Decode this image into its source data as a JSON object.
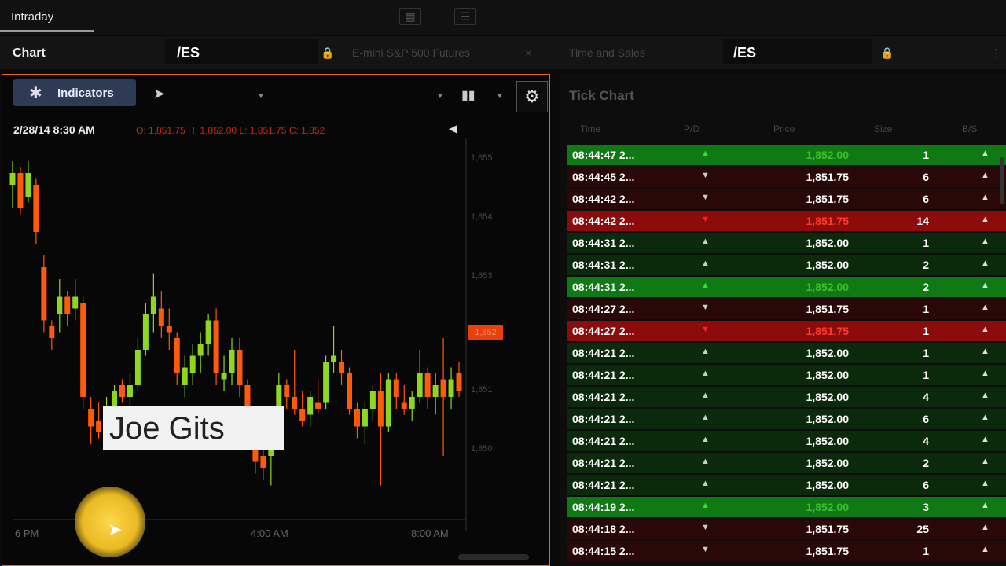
{
  "topbar": {
    "tab": "Intraday"
  },
  "header": {
    "chart_label": "Chart",
    "chart_symbol": "/ES",
    "instrument_name": "E-mini S&P 500 Futures",
    "time_sales_label": "Time and Sales",
    "ts_symbol": "/ES"
  },
  "chart": {
    "indicators_label": "Indicators",
    "datetime": "2/28/14 8:30 AM",
    "ohlc": "O: 1,851.75 H: 1,852.00 L: 1,851.75 C: 1,852",
    "watermark": "Joe Gits",
    "x_ticks": [
      "6 PM",
      "4:00 AM",
      "8:00 AM"
    ],
    "y_ticks": [
      "1,855",
      "1,854",
      "1,853",
      "1,852",
      "1,851",
      "1,850"
    ],
    "current_price": "1,852",
    "colors": {
      "up": "#8fd61e",
      "down": "#ff5a0a",
      "panel_border": "#e86a14"
    }
  },
  "chart_data": {
    "type": "candlestick",
    "title": "",
    "candles": [
      {
        "o": 1855.8,
        "h": 1856.2,
        "l": 1855.4,
        "c": 1856.0
      },
      {
        "o": 1856.0,
        "h": 1856.1,
        "l": 1855.3,
        "c": 1855.4
      },
      {
        "o": 1855.6,
        "h": 1856.2,
        "l": 1855.5,
        "c": 1856.0
      },
      {
        "o": 1855.8,
        "h": 1855.9,
        "l": 1854.8,
        "c": 1855.0
      },
      {
        "o": 1854.4,
        "h": 1854.6,
        "l": 1853.3,
        "c": 1853.5
      },
      {
        "o": 1853.4,
        "h": 1853.5,
        "l": 1853.0,
        "c": 1853.2
      },
      {
        "o": 1853.6,
        "h": 1854.2,
        "l": 1853.3,
        "c": 1853.9
      },
      {
        "o": 1853.9,
        "h": 1854.0,
        "l": 1853.4,
        "c": 1853.6
      },
      {
        "o": 1853.7,
        "h": 1854.2,
        "l": 1853.5,
        "c": 1853.9
      },
      {
        "o": 1853.8,
        "h": 1853.9,
        "l": 1852.0,
        "c": 1852.2
      },
      {
        "o": 1852.0,
        "h": 1852.2,
        "l": 1851.4,
        "c": 1851.7
      },
      {
        "o": 1851.8,
        "h": 1852.1,
        "l": 1851.5,
        "c": 1851.6
      },
      {
        "o": 1851.6,
        "h": 1852.2,
        "l": 1851.3,
        "c": 1852.0
      },
      {
        "o": 1852.0,
        "h": 1852.4,
        "l": 1851.9,
        "c": 1852.3
      },
      {
        "o": 1852.4,
        "h": 1852.5,
        "l": 1852.1,
        "c": 1852.2
      },
      {
        "o": 1852.2,
        "h": 1852.6,
        "l": 1852.0,
        "c": 1852.4
      },
      {
        "o": 1852.4,
        "h": 1853.2,
        "l": 1852.3,
        "c": 1853.0
      },
      {
        "o": 1853.0,
        "h": 1853.8,
        "l": 1852.9,
        "c": 1853.6
      },
      {
        "o": 1853.6,
        "h": 1854.3,
        "l": 1853.3,
        "c": 1853.9
      },
      {
        "o": 1853.7,
        "h": 1854.0,
        "l": 1853.2,
        "c": 1853.4
      },
      {
        "o": 1853.4,
        "h": 1853.7,
        "l": 1853.0,
        "c": 1853.3
      },
      {
        "o": 1853.2,
        "h": 1853.3,
        "l": 1852.4,
        "c": 1852.6
      },
      {
        "o": 1852.4,
        "h": 1852.9,
        "l": 1852.2,
        "c": 1852.7
      },
      {
        "o": 1852.6,
        "h": 1853.1,
        "l": 1852.4,
        "c": 1852.9
      },
      {
        "o": 1852.9,
        "h": 1853.3,
        "l": 1852.6,
        "c": 1853.1
      },
      {
        "o": 1853.1,
        "h": 1853.6,
        "l": 1852.9,
        "c": 1853.5
      },
      {
        "o": 1853.5,
        "h": 1853.7,
        "l": 1852.4,
        "c": 1852.6
      },
      {
        "o": 1852.5,
        "h": 1852.9,
        "l": 1852.3,
        "c": 1852.6
      },
      {
        "o": 1852.6,
        "h": 1853.2,
        "l": 1852.4,
        "c": 1853.0
      },
      {
        "o": 1853.0,
        "h": 1853.2,
        "l": 1852.2,
        "c": 1852.4
      },
      {
        "o": 1852.4,
        "h": 1852.5,
        "l": 1851.6,
        "c": 1851.8
      },
      {
        "o": 1851.9,
        "h": 1852.0,
        "l": 1850.9,
        "c": 1851.1
      },
      {
        "o": 1851.2,
        "h": 1851.3,
        "l": 1850.8,
        "c": 1851.0
      },
      {
        "o": 1851.2,
        "h": 1851.8,
        "l": 1850.7,
        "c": 1851.6
      },
      {
        "o": 1851.7,
        "h": 1852.6,
        "l": 1851.6,
        "c": 1852.4
      },
      {
        "o": 1852.4,
        "h": 1852.5,
        "l": 1852.0,
        "c": 1852.2
      },
      {
        "o": 1852.2,
        "h": 1853.0,
        "l": 1851.9,
        "c": 1852.0
      },
      {
        "o": 1852.0,
        "h": 1852.3,
        "l": 1851.7,
        "c": 1851.8
      },
      {
        "o": 1851.9,
        "h": 1852.3,
        "l": 1851.7,
        "c": 1852.2
      },
      {
        "o": 1852.1,
        "h": 1852.5,
        "l": 1851.9,
        "c": 1852.0
      },
      {
        "o": 1852.1,
        "h": 1852.9,
        "l": 1852.0,
        "c": 1852.8
      },
      {
        "o": 1852.8,
        "h": 1853.4,
        "l": 1852.6,
        "c": 1852.9
      },
      {
        "o": 1852.8,
        "h": 1853.0,
        "l": 1852.4,
        "c": 1852.6
      },
      {
        "o": 1852.6,
        "h": 1852.7,
        "l": 1851.9,
        "c": 1852.0
      },
      {
        "o": 1852.0,
        "h": 1852.1,
        "l": 1851.5,
        "c": 1851.7
      },
      {
        "o": 1851.7,
        "h": 1852.1,
        "l": 1851.4,
        "c": 1852.0
      },
      {
        "o": 1852.0,
        "h": 1852.4,
        "l": 1851.8,
        "c": 1852.3
      },
      {
        "o": 1852.3,
        "h": 1852.6,
        "l": 1850.7,
        "c": 1851.7
      },
      {
        "o": 1851.7,
        "h": 1852.6,
        "l": 1851.6,
        "c": 1852.5
      },
      {
        "o": 1852.5,
        "h": 1852.6,
        "l": 1852.0,
        "c": 1852.2
      },
      {
        "o": 1852.1,
        "h": 1852.4,
        "l": 1851.9,
        "c": 1852.0
      },
      {
        "o": 1852.0,
        "h": 1852.3,
        "l": 1851.8,
        "c": 1852.2
      },
      {
        "o": 1852.2,
        "h": 1853.0,
        "l": 1852.1,
        "c": 1852.6
      },
      {
        "o": 1852.6,
        "h": 1852.7,
        "l": 1852.0,
        "c": 1852.2
      },
      {
        "o": 1852.2,
        "h": 1852.6,
        "l": 1851.9,
        "c": 1852.4
      },
      {
        "o": 1852.5,
        "h": 1853.2,
        "l": 1851.2,
        "c": 1852.2
      },
      {
        "o": 1852.2,
        "h": 1852.7,
        "l": 1852.0,
        "c": 1852.5
      },
      {
        "o": 1852.6,
        "h": 1852.8,
        "l": 1852.2,
        "c": 1852.3
      }
    ],
    "ylim": [
      1850.2,
      1856.6
    ],
    "xlabel": "",
    "ylabel": ""
  },
  "tick_chart": {
    "title": "Tick Chart",
    "columns": [
      "Time",
      "P/D",
      "Price",
      "Size",
      "B/S"
    ],
    "rows": [
      {
        "time": "08:44:47 2...",
        "dir": "up",
        "price": "1,852.00",
        "size": "1",
        "kind": "up-strong"
      },
      {
        "time": "08:44:45 2...",
        "dir": "down",
        "price": "1,851.75",
        "size": "6",
        "kind": "down-dim"
      },
      {
        "time": "08:44:42 2...",
        "dir": "down",
        "price": "1,851.75",
        "size": "6",
        "kind": "down-dim"
      },
      {
        "time": "08:44:42 2...",
        "dir": "down",
        "price": "1,851.75",
        "size": "14",
        "kind": "down-strong"
      },
      {
        "time": "08:44:31 2...",
        "dir": "up",
        "price": "1,852.00",
        "size": "1",
        "kind": "up-dim"
      },
      {
        "time": "08:44:31 2...",
        "dir": "up",
        "price": "1,852.00",
        "size": "2",
        "kind": "up-dim"
      },
      {
        "time": "08:44:31 2...",
        "dir": "up",
        "price": "1,852.00",
        "size": "2",
        "kind": "up-strong"
      },
      {
        "time": "08:44:27 2...",
        "dir": "down",
        "price": "1,851.75",
        "size": "1",
        "kind": "down-dim"
      },
      {
        "time": "08:44:27 2...",
        "dir": "down",
        "price": "1,851.75",
        "size": "1",
        "kind": "down-strong"
      },
      {
        "time": "08:44:21 2...",
        "dir": "up",
        "price": "1,852.00",
        "size": "1",
        "kind": "up-dim"
      },
      {
        "time": "08:44:21 2...",
        "dir": "up",
        "price": "1,852.00",
        "size": "1",
        "kind": "up-dim"
      },
      {
        "time": "08:44:21 2...",
        "dir": "up",
        "price": "1,852.00",
        "size": "4",
        "kind": "up-dim"
      },
      {
        "time": "08:44:21 2...",
        "dir": "up",
        "price": "1,852.00",
        "size": "6",
        "kind": "up-dim"
      },
      {
        "time": "08:44:21 2...",
        "dir": "up",
        "price": "1,852.00",
        "size": "4",
        "kind": "up-dim"
      },
      {
        "time": "08:44:21 2...",
        "dir": "up",
        "price": "1,852.00",
        "size": "2",
        "kind": "up-dim"
      },
      {
        "time": "08:44:21 2...",
        "dir": "up",
        "price": "1,852.00",
        "size": "6",
        "kind": "up-dim"
      },
      {
        "time": "08:44:19 2...",
        "dir": "up",
        "price": "1,852.00",
        "size": "3",
        "kind": "up-strong"
      },
      {
        "time": "08:44:18 2...",
        "dir": "down",
        "price": "1,851.75",
        "size": "25",
        "kind": "down-dim"
      },
      {
        "time": "08:44:15 2...",
        "dir": "down",
        "price": "1,851.75",
        "size": "1",
        "kind": "down-dim"
      }
    ],
    "colors": {
      "up-strong": "#0f7a14",
      "up-dim": "#0b2a0c",
      "down-strong": "#8c0c0c",
      "down-dim": "#2a0808",
      "up-strong-price": "#3bbf2a",
      "down-strong-price": "#ff3a2a"
    }
  }
}
